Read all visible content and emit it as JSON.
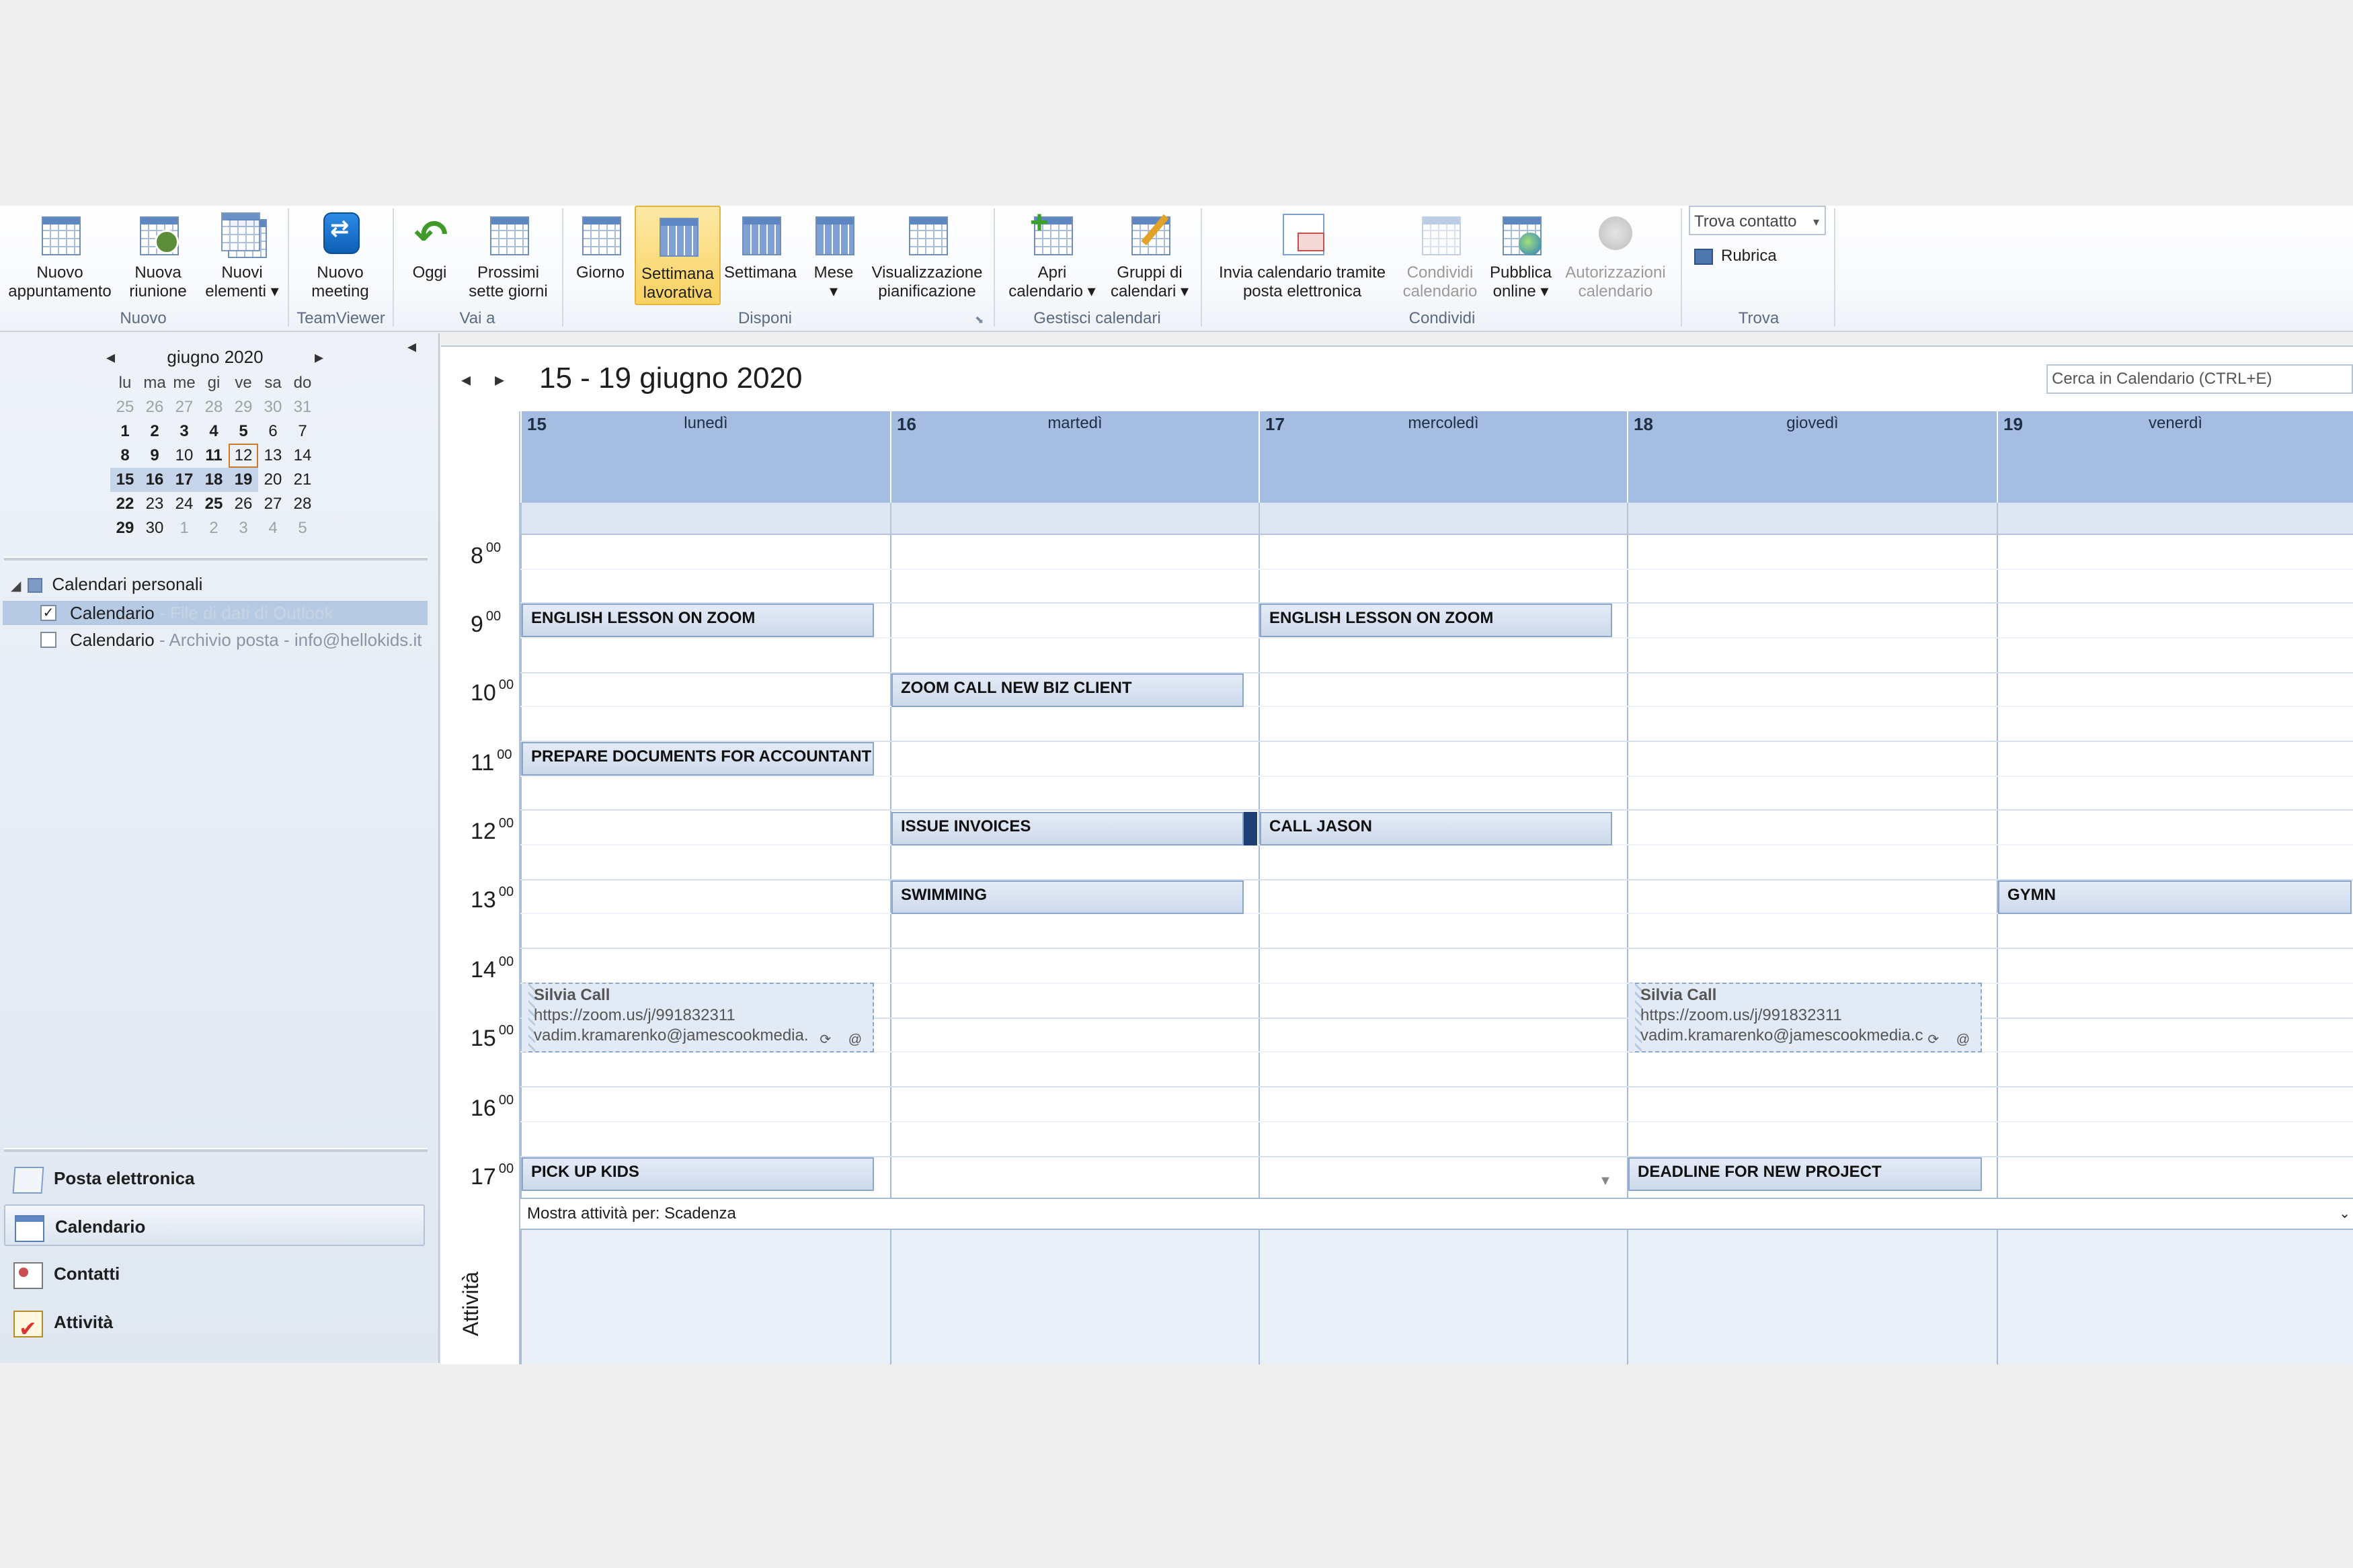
{
  "ribbon": {
    "buttons": {
      "new_appointment": "Nuovo\nappuntamento",
      "new_meeting": "Nuova\nriunione",
      "new_items": "Nuovi\nelementi ▾",
      "teamviewer_meeting": "Nuovo\nmeeting",
      "today": "Oggi",
      "next_seven": "Prossimi\nsette giorni",
      "day": "Giorno",
      "work_week": "Settimana\nlavorativa",
      "week": "Settimana",
      "month": "Mese\n▾",
      "schedule_view": "Visualizzazione\npianificazione",
      "open_calendar": "Apri\ncalendario ▾",
      "calendar_groups": "Gruppi di\ncalendari ▾",
      "email_calendar": "Invia calendario tramite\nposta elettronica",
      "share_calendar": "Condividi\ncalendario",
      "publish_online": "Pubblica\nonline ▾",
      "calendar_permissions": "Autorizzazioni\ncalendario",
      "find_contact": "Trova contatto",
      "address_book": "Rubrica"
    },
    "groups": {
      "new": "Nuovo",
      "teamviewer": "TeamViewer",
      "goto": "Vai a",
      "arrange": "Disponi",
      "manage": "Gestisci calendari",
      "share": "Condividi",
      "find": "Trova"
    }
  },
  "nav": {
    "mini_calendar": {
      "title": "giugno 2020",
      "weekdays": [
        "lu",
        "ma",
        "me",
        "gi",
        "ve",
        "sa",
        "do"
      ],
      "weeks": [
        [
          "25",
          "26",
          "27",
          "28",
          "29",
          "30",
          "31"
        ],
        [
          "1",
          "2",
          "3",
          "4",
          "5",
          "6",
          "7"
        ],
        [
          "8",
          "9",
          "10",
          "11",
          "12",
          "13",
          "14"
        ],
        [
          "15",
          "16",
          "17",
          "18",
          "19",
          "20",
          "21"
        ],
        [
          "22",
          "23",
          "24",
          "25",
          "26",
          "27",
          "28"
        ],
        [
          "29",
          "30",
          "1",
          "2",
          "3",
          "4",
          "5"
        ]
      ]
    },
    "tree_header": "Calendari personali",
    "calendars": [
      {
        "name": "Calendario",
        "sub": " - File di dati di Outlook",
        "checked": "✓"
      },
      {
        "name": "Calendario",
        "sub": " - Archivio posta - info@hellokids.it",
        "checked": ""
      }
    ],
    "modules": [
      "Posta elettronica",
      "Calendario",
      "Contatti",
      "Attività"
    ]
  },
  "calendar": {
    "range_title": "15 - 19 giugno 2020",
    "search_placeholder": "Cerca in Calendario (CTRL+E)",
    "days": [
      {
        "num": "15",
        "name": "lunedì"
      },
      {
        "num": "16",
        "name": "martedì"
      },
      {
        "num": "17",
        "name": "mercoledì"
      },
      {
        "num": "18",
        "name": "giovedì"
      },
      {
        "num": "19",
        "name": "venerdì"
      }
    ],
    "hours": [
      "8",
      "9",
      "10",
      "11",
      "12",
      "13",
      "14",
      "15",
      "16",
      "17"
    ],
    "minutes_label": "00",
    "appointments": {
      "mon_english": "ENGLISH LESSON ON ZOOM",
      "wed_english": "ENGLISH LESSON ON ZOOM",
      "tue_zoom": "ZOOM CALL  NEW BIZ CLIENT",
      "mon_docs": "PREPARE DOCUMENTS FOR ACCOUNTANT",
      "tue_invoices": "ISSUE INVOICES",
      "wed_jason": "CALL JASON",
      "tue_swimming": "SWIMMING",
      "fri_gymn": "GYMN",
      "mon_kids": "PICK UP KIDS",
      "thu_deadline": "DEADLINE FOR NEW PROJECT"
    },
    "tentative": {
      "title": "Silvia Call",
      "line2": "https://zoom.us/j/991832311",
      "line3": "vadim.kramarenko@jamescookmedia.",
      "line3b": "vadim.kramarenko@jamescookmedia.c",
      "icons": "⟳ @"
    },
    "tasks_bar": "Mostra attività per: Scadenza",
    "tasks_label": "Attività"
  }
}
